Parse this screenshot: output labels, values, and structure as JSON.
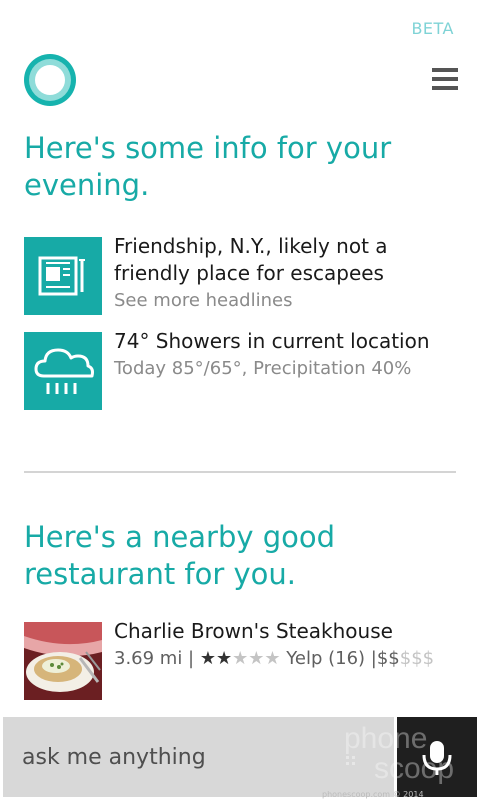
{
  "beta_label": "BETA",
  "sections": {
    "evening": {
      "heading": "Here's some info for your evening."
    },
    "news": {
      "title": "Friendship, N.Y., likely not a friendly place for escapees",
      "link": "See more headlines",
      "icon": "newspaper-icon"
    },
    "weather": {
      "title": "74° Showers in current location",
      "details": "Today 85°/65°, Precipitation 40%",
      "icon": "rain-cloud-icon"
    },
    "restaurant": {
      "heading": "Here's a nearby good restaurant for you.",
      "name": "Charlie Brown's Steakhouse",
      "distance": "3.69 mi |",
      "rating": 2,
      "rating_max": 5,
      "reviews": "Yelp (16) |",
      "price_on": "$$",
      "price_off": "$$$",
      "photo": "steak-dish-photo"
    }
  },
  "search": {
    "placeholder": "ask me anything"
  },
  "watermark": {
    "text": "Phone Scoop",
    "footer": "phonescoop.com © 2014"
  },
  "colors": {
    "accent": "#17aaa6",
    "accent_light": "#8fdcd9",
    "mic_bg": "#1f1f1f",
    "bar_bg": "#d8d8d8"
  }
}
